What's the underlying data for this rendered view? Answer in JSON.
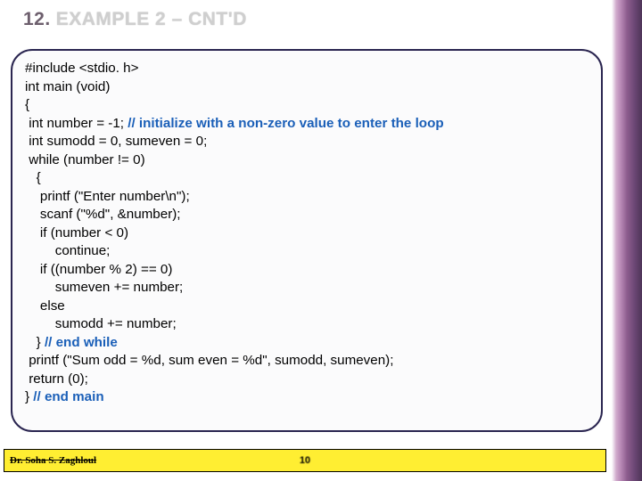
{
  "slide": {
    "number": "12.",
    "title": "EXAMPLE 2 – CNT'D"
  },
  "code": {
    "l1": "#include <stdio. h>",
    "l2": "int main (void)",
    "l3": "{",
    "l4a": " int number = -1; ",
    "l4b": "// initialize with a non-zero value to enter the loop",
    "l5": " int sumodd = 0, sumeven = 0;",
    "l6": " while (number != 0)",
    "l7": "   {",
    "l8": "    printf (\"Enter number\\n\");",
    "l9": "    scanf (\"%d\", &number);",
    "l10": "    if (number < 0)",
    "l11": "        continue;",
    "l12": "    if ((number % 2) == 0)",
    "l13": "        sumeven += number;",
    "l14": "    else",
    "l15": "        sumodd += number;",
    "l16a": "   } ",
    "l16b": "// end while",
    "l17": " printf (\"Sum odd = %d, sum even = %d\", sumodd, sumeven);",
    "l18": " return (0);",
    "l19a": "} ",
    "l19b": "// end main"
  },
  "footer": {
    "author": "Dr. Soha S. Zaghloul",
    "page": "10"
  }
}
